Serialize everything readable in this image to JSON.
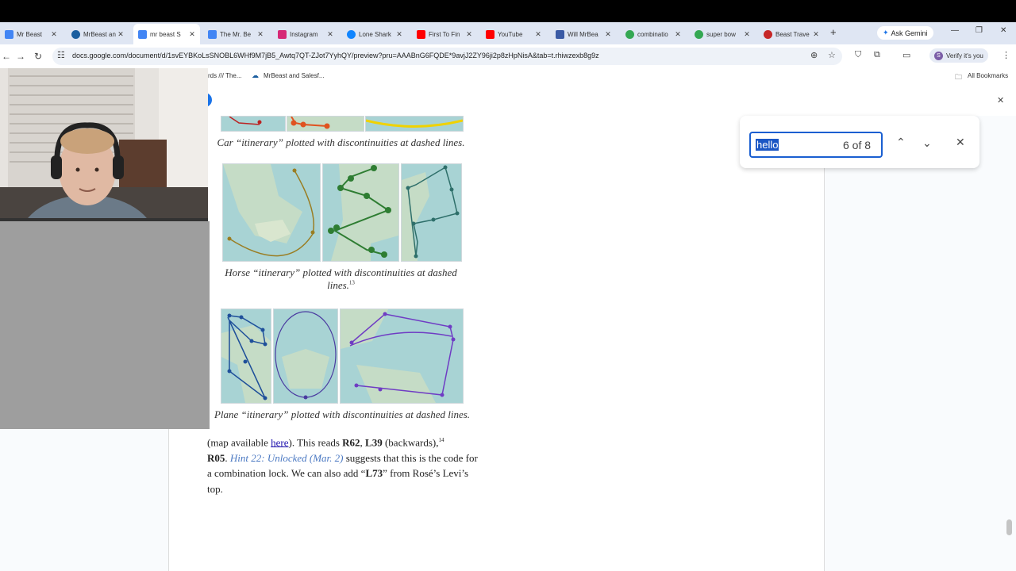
{
  "tabs": [
    {
      "label": "Mr Beast",
      "color": "#4285f4",
      "active": false
    },
    {
      "label": "MrBeast an",
      "color": "#1b5e9f",
      "active": false
    },
    {
      "label": "mr beast S",
      "color": "#4285f4",
      "active": true
    },
    {
      "label": "The Mr. Be",
      "color": "#4285f4",
      "active": false
    },
    {
      "label": "Instagram",
      "color": "#d62976",
      "active": false
    },
    {
      "label": "Lone Shark",
      "color": "#1185fe",
      "active": false
    },
    {
      "label": "First To Fin",
      "color": "#ff0000",
      "active": false
    },
    {
      "label": "YouTube",
      "color": "#ff0000",
      "active": false
    },
    {
      "label": "Will MrBea",
      "color": "#3b5ba5",
      "active": false
    },
    {
      "label": "combinatio",
      "color": "#34a853",
      "active": false
    },
    {
      "label": "super bow",
      "color": "#34a853",
      "active": false
    },
    {
      "label": "Beast Trave",
      "color": "#c62828",
      "active": false
    }
  ],
  "browser": {
    "ask_gemini": "Ask Gemini",
    "url": "docs.google.com/document/d/1svEYBKoLsSNOBL6WHf9M7jB5_Awtq7QT-ZJot7YyhQY/preview?pru=AAABnG6FQDE*9avjJ2ZY96ji2p8zHpNisA&tab=t.rhiwzexb8g9z",
    "verify_label": "Verify it's you",
    "all_bookmarks": "All Bookmarks",
    "bookmark1": "rds /// The...",
    "bookmark2": "MrBeast and Salesf..."
  },
  "find": {
    "query": "hello",
    "count": "6 of 8"
  },
  "doc": {
    "car_caption": "Car “itinerary” plotted with discontinuities at dashed lines.",
    "horse_caption_line1": "Horse “itinerary” plotted with discontinuities at dashed",
    "horse_caption_line2": "lines.",
    "horse_footnote": "13",
    "plane_caption": "Plane “itinerary” plotted with discontinuities at dashed lines.",
    "para": {
      "t1": "(map available ",
      "link": "here",
      "t2": "). This reads ",
      "b1": "R62",
      "t3": ", ",
      "b2": "L39",
      "t4": " (backwards),",
      "fn": "14",
      "b3": "R05",
      "t5": ". ",
      "hint": "Hint 22: Unlocked (Mar. 2)",
      "t6": " suggests that this is the code for a combination lock. We can also add “",
      "b4": "L73",
      "t7": "” from Rosé’s Levi’s top."
    }
  },
  "colors": {
    "map_water": "#a8d3d4",
    "map_land": "#c5dcc6",
    "horse_route": "#9a7d22",
    "horse_route2": "#2e7d32",
    "plane_route": "#1e4f9a",
    "plane_route2": "#6f3cc4",
    "find_highlight": "#1a56c4"
  }
}
